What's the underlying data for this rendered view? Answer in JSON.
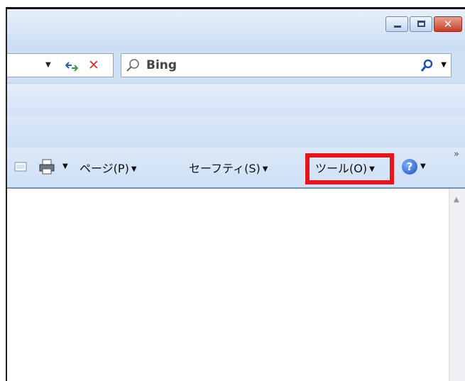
{
  "window": {
    "minimize": "–",
    "maximize": "□",
    "close": "✕"
  },
  "address": {
    "dropdown": "▼",
    "stop": "✕"
  },
  "search": {
    "value": "Bing",
    "dropdown": "▼"
  },
  "commandbar": {
    "print_dropdown": "▼",
    "page_label": "ページ(P)",
    "safety_label": "セーフティ(S)",
    "tools_label": "ツール(O)",
    "help_icon": "?",
    "dropdown": "▼",
    "overflow": "»"
  },
  "scroll": {
    "up": "▲"
  },
  "colors": {
    "highlight": "#e8141a",
    "close_button": "#c4402b",
    "stop": "#d4322a"
  }
}
